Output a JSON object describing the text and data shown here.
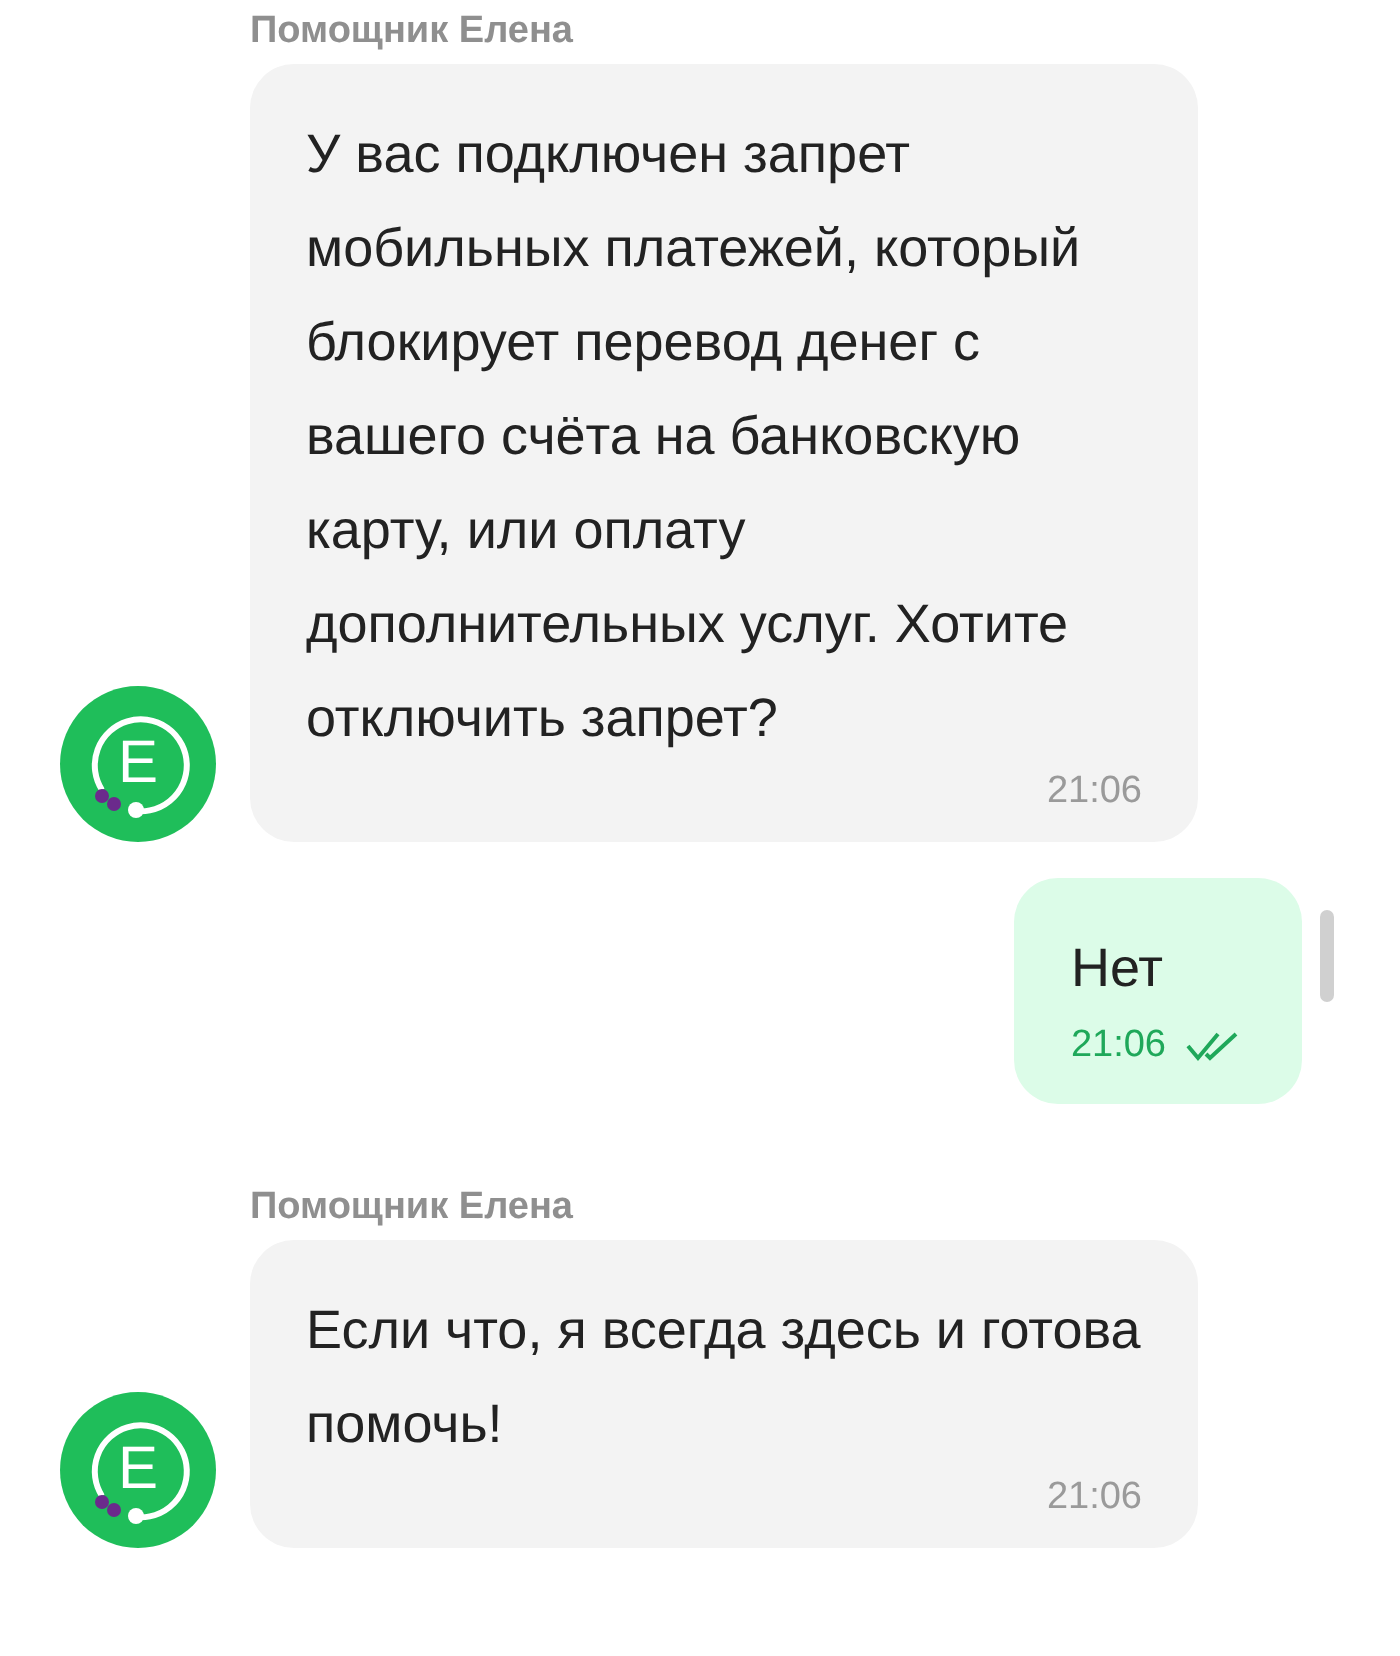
{
  "messages": [
    {
      "kind": "incoming",
      "sender": "Помощник Елена",
      "avatar_letter": "E",
      "text": "У вас подключен запрет мобильных платежей, который блокирует перевод денег с вашего счёта на банковскую карту, или оплату дополнительных услуг. Хотите отключить запрет?",
      "time": "21:06"
    },
    {
      "kind": "outgoing",
      "text": "Нет",
      "time": "21:06",
      "read": true
    },
    {
      "kind": "incoming",
      "sender": "Помощник Елена",
      "avatar_letter": "E",
      "text": "Если что, я всегда здесь и готова помочь!",
      "time": "21:06"
    }
  ]
}
